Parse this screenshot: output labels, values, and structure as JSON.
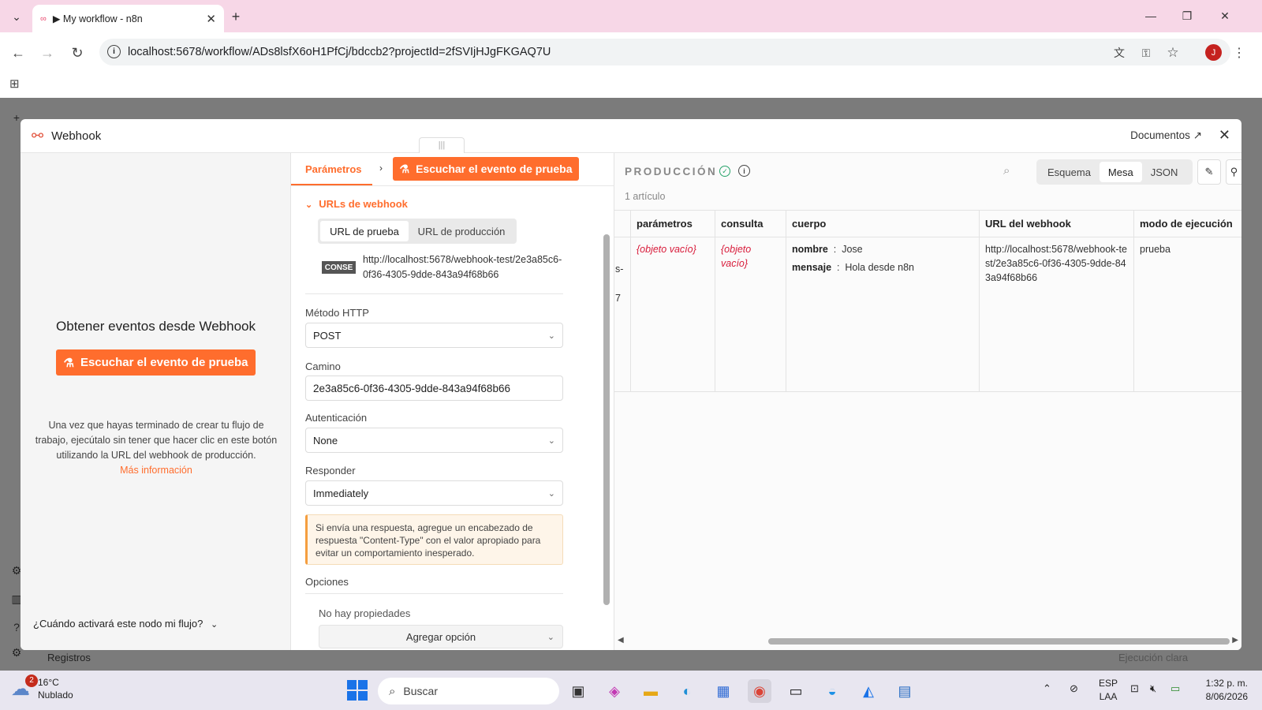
{
  "browser": {
    "tab_title": "▶ My workflow - n8n",
    "tab_favicon": "∞",
    "url": "localhost:5678/workflow/ADs8lsfX6oH1PfCj/bdccb2?projectId=2fSVIjHJgFKGAQ7U",
    "profile_initial": "J"
  },
  "modal": {
    "title": "Webhook",
    "docs_label": "Documentos",
    "left": {
      "heading": "Obtener eventos desde Webhook",
      "listen_button": "Escuchar el evento de prueba",
      "description": "Una vez que hayas terminado de crear tu flujo de trabajo, ejecútalo sin tener que hacer clic en este botón utilizando la URL del webhook de producción.",
      "more_info": "Más información",
      "activate_question": "¿Cuándo activará este nodo mi flujo?"
    },
    "middle": {
      "tab_params": "Parámetros",
      "listen_button": "Escuchar el evento de prueba",
      "webhook_urls_title": "URLs de webhook",
      "seg_test": "URL de prueba",
      "seg_prod": "URL de producción",
      "method_badge": "CONSE",
      "webhook_url": "http://localhost:5678/webhook-test/2e3a85c6-0f36-4305-9dde-843a94f68b66",
      "http_method_label": "Método HTTP",
      "http_method_value": "POST",
      "path_label": "Camino",
      "path_value": "2e3a85c6-0f36-4305-9dde-843a94f68b66",
      "auth_label": "Autenticación",
      "auth_value": "None",
      "respond_label": "Responder",
      "respond_value": "Immediately",
      "notice": "Si envía una respuesta, agregue un encabezado de respuesta \"Content-Type\" con el valor apropiado para evitar un comportamiento inesperado.",
      "options_label": "Opciones",
      "no_props": "No hay propiedades",
      "add_option": "Agregar opción"
    },
    "right": {
      "output_label": "PRODUCCIÓN",
      "item_count": "1 artículo",
      "view_schema": "Esquema",
      "view_table": "Mesa",
      "view_json": "JSON",
      "columns": [
        "parámetros",
        "consulta",
        "cuerpo",
        "URL del webhook",
        "modo de ejecución"
      ],
      "row": {
        "params": "{objeto vacío}",
        "query": "{objeto vacío}",
        "body_key1": "nombre",
        "body_val1": "Jose",
        "body_key2": "mensaje",
        "body_val2": "Hola desde n8n",
        "webhook_url": "http://localhost:5678/webhook-test/2e3a85c6-0f36-4305-9dde-843a94f68b66",
        "exec_mode": "prueba"
      },
      "cutoff_left_1": "s-",
      "cutoff_left_2": "7"
    }
  },
  "app_bottom": {
    "logs": "Registros",
    "clear_exec": "Ejecución clara"
  },
  "taskbar": {
    "notif_count": "2",
    "temperature": "16°C",
    "weather": "Nublado",
    "search_placeholder": "Buscar",
    "lang_1": "ESP",
    "lang_2": "LAA",
    "time": "1:32 p. m.",
    "date": "8/06/2026"
  },
  "colors": {
    "accent": "#ff6d2d",
    "empty_value": "#d81b3a",
    "success": "#26a269"
  }
}
